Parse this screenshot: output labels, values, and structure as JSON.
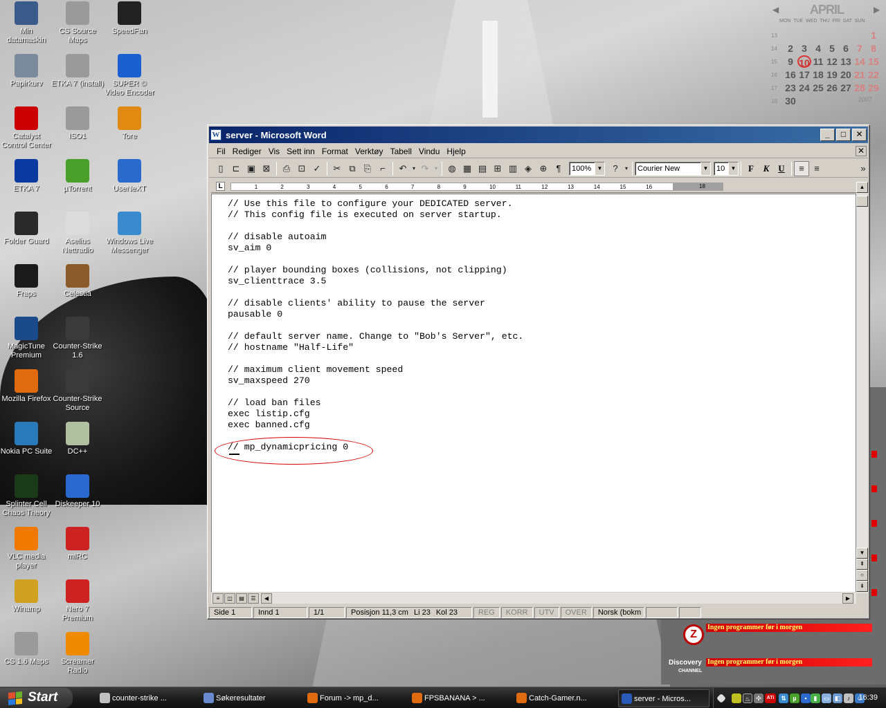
{
  "desktop": {
    "icons": [
      {
        "label": "Min datamaskin",
        "icon": "computer-icon",
        "color": "#3a5a8a"
      },
      {
        "label": "CS Source Maps",
        "icon": "folder-icon",
        "color": "#9a9a9a"
      },
      {
        "label": "SpeedFan",
        "icon": "fan-icon",
        "color": "#222222"
      },
      {
        "label": "Papirkurv",
        "icon": "recycle-bin-icon",
        "color": "#7a8a9a"
      },
      {
        "label": "ETKA 7 (install)",
        "icon": "folder-icon",
        "color": "#9a9a9a"
      },
      {
        "label": "SUPER © Video Encoder",
        "icon": "super-icon",
        "color": "#1a5fcf"
      },
      {
        "label": "Catalyst Control Center",
        "icon": "ati-icon",
        "color": "#cc0000"
      },
      {
        "label": "ISO1",
        "icon": "folder-icon",
        "color": "#9a9a9a"
      },
      {
        "label": "Tore",
        "icon": "winamp-shortcut-icon",
        "color": "#e08a10"
      },
      {
        "label": "ETKA 7",
        "icon": "etka-icon",
        "color": "#0a3aa0"
      },
      {
        "label": "µTorrent",
        "icon": "utorrent-icon",
        "color": "#4aa02a"
      },
      {
        "label": "UseNeXT",
        "icon": "usenext-icon",
        "color": "#2a6acc"
      },
      {
        "label": "Folder Guard",
        "icon": "folder-guard-icon",
        "color": "#2a2a2a"
      },
      {
        "label": "Aselius Nettradio",
        "icon": "nettradio-icon",
        "color": "#dcdcdc"
      },
      {
        "label": "Windows Live Messenger",
        "icon": "messenger-icon",
        "color": "#3a8ad0"
      },
      {
        "label": "Fraps",
        "icon": "fraps-icon",
        "color": "#1a1a1a"
      },
      {
        "label": "Celestia",
        "icon": "celestia-icon",
        "color": "#8a5a2a"
      },
      {
        "label": "MagicTune Premium",
        "icon": "magictune-icon",
        "color": "#1a4a8a"
      },
      {
        "label": "Counter-Strike 1.6",
        "icon": "counter-strike-icon",
        "color": "#3a3a3a"
      },
      {
        "label": "Mozilla Firefox",
        "icon": "firefox-icon",
        "color": "#e06a10"
      },
      {
        "label": "Counter-Strike Source",
        "icon": "counter-strike-icon",
        "color": "#3a3a3a"
      },
      {
        "label": "Nokia PC Suite",
        "icon": "nokia-icon",
        "color": "#2a7aba"
      },
      {
        "label": "DC++",
        "icon": "dcpp-icon",
        "color": "#b0c0a0"
      },
      {
        "label": "Splinter Cell Chaos Theory",
        "icon": "splinter-cell-icon",
        "color": "#1a3a1a"
      },
      {
        "label": "Diskeeper 10",
        "icon": "diskeeper-icon",
        "color": "#2a6ad0"
      },
      {
        "label": "VLC media player",
        "icon": "vlc-icon",
        "color": "#f07a00"
      },
      {
        "label": "mIRC",
        "icon": "mirc-icon",
        "color": "#cc2222"
      },
      {
        "label": "Winamp",
        "icon": "winamp-icon",
        "color": "#d0a020"
      },
      {
        "label": "Nero 7 Premium",
        "icon": "nero-icon",
        "color": "#cc2222"
      },
      {
        "label": "CS 1.6 Maps",
        "icon": "folder-icon",
        "color": "#9a9a9a"
      },
      {
        "label": "Screamer Radio",
        "icon": "screamer-icon",
        "color": "#f08a00"
      }
    ]
  },
  "calendar": {
    "month": "APRIL",
    "weekdays": "MON TUE WED THU FRI SAT SUN",
    "weeks": [
      "13",
      "14",
      "15",
      "16",
      "17",
      "18"
    ],
    "days": [
      "",
      "",
      "",
      "",
      "",
      "",
      "1",
      "2",
      "3",
      "4",
      "5",
      "6",
      "7",
      "8",
      "9",
      "10",
      "11",
      "12",
      "13",
      "14",
      "15",
      "16",
      "17",
      "18",
      "19",
      "20",
      "21",
      "22",
      "23",
      "24",
      "25",
      "26",
      "27",
      "28",
      "29",
      "30",
      "",
      "",
      "",
      "",
      "",
      ""
    ],
    "today": "10",
    "year": "2007"
  },
  "window": {
    "title": "server - Microsoft Word",
    "app_icon": "W",
    "menu": [
      "Fil",
      "Rediger",
      "Vis",
      "Sett inn",
      "Format",
      "Verktøy",
      "Tabell",
      "Vindu",
      "Hjelp"
    ],
    "zoom": "100%",
    "font": "Courier New",
    "font_size": "10",
    "bold_label": "F",
    "italic_label": "K",
    "underline_label": "U",
    "ruler_numbers": [
      "1",
      "2",
      "3",
      "4",
      "5",
      "6",
      "7",
      "8",
      "9",
      "10",
      "11",
      "12",
      "13",
      "14",
      "15",
      "16",
      "18"
    ],
    "document_lines": [
      "// Use this file to configure your DEDICATED server.",
      "// This config file is executed on server startup.",
      "",
      "// disable autoaim",
      "sv_aim 0",
      "",
      "// player bounding boxes (collisions, not clipping)",
      "sv_clienttrace 3.5",
      "",
      "// disable clients' ability to pause the server",
      "pausable 0",
      "",
      "// default server name. Change to \"Bob's Server\", etc.",
      "// hostname \"Half-Life\"",
      "",
      "// maximum client movement speed",
      "sv_maxspeed 270",
      "",
      "// load ban files",
      "exec listip.cfg",
      "exec banned.cfg",
      "",
      "// mp_dynamicpricing 0"
    ],
    "status": {
      "page": "Side 1",
      "section": "Innd 1",
      "pages": "1/1",
      "position": "Posisjon 11,3 cm",
      "line": "Li 23",
      "column": "Kol 23",
      "rec": "REG",
      "trk": "KORR",
      "ext": "UTV",
      "ovr": "OVER",
      "language": "Norsk (bokm"
    }
  },
  "widgets": {
    "zonealarm_text": "Ingen programmer før i morgen",
    "discovery_text": "Ingen programmer før i morgen",
    "discovery_logo": "Discovery",
    "discovery_sub": "CHANNEL"
  },
  "taskbar": {
    "start_label": "Start",
    "tasks": [
      {
        "label": "counter-strike ...",
        "icon": "folder-icon",
        "color": "#c0c0c0"
      },
      {
        "label": "Søkeresultater",
        "icon": "search-results-icon",
        "color": "#6a8ad0"
      },
      {
        "label": "Forum -> mp_d...",
        "icon": "firefox-icon",
        "color": "#e06a10"
      },
      {
        "label": "FPSBANANA > ...",
        "icon": "firefox-icon",
        "color": "#e06a10"
      },
      {
        "label": "Catch-Gamer.n...",
        "icon": "firefox-icon",
        "color": "#e06a10"
      },
      {
        "label": "server - Micros...",
        "icon": "word-icon",
        "color": "#2a5aba"
      }
    ],
    "clock": "16:39"
  }
}
